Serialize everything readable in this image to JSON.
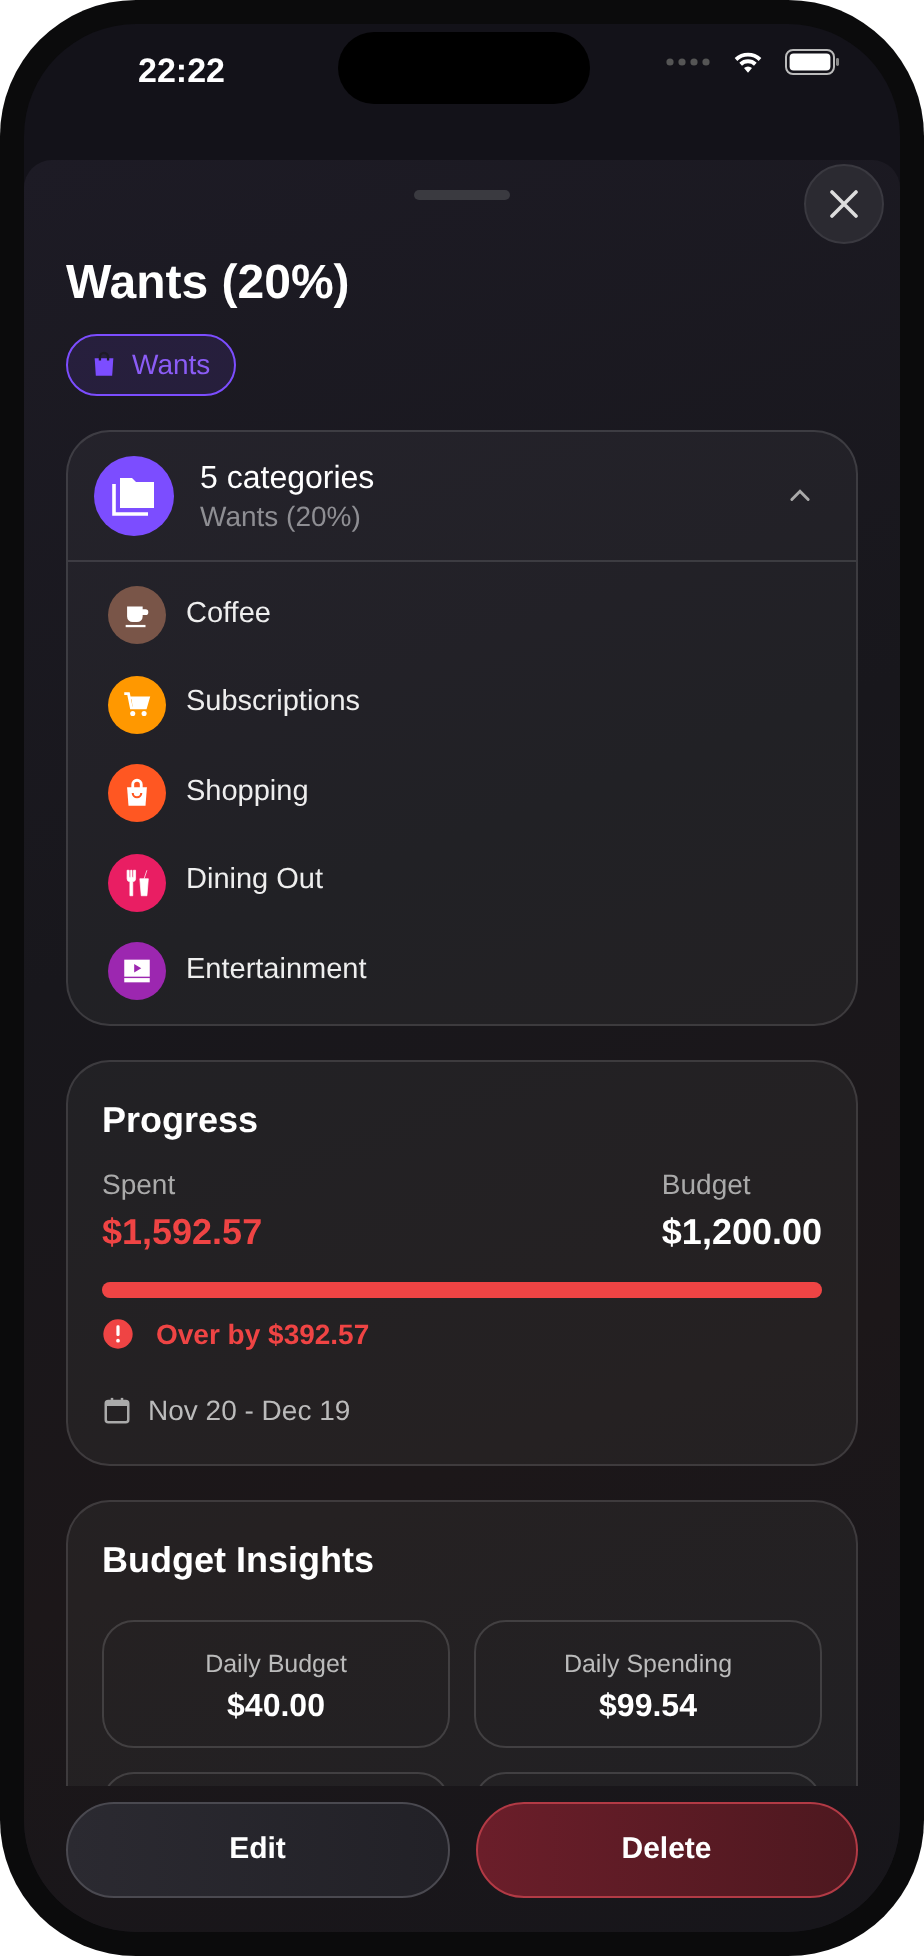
{
  "status_bar": {
    "time": "22:22"
  },
  "sheet": {
    "title": "Wants (20%)",
    "chip": "Wants"
  },
  "categories": {
    "title": "5 categories",
    "subtitle": "Wants (20%)",
    "expanded": true,
    "items": [
      {
        "name": "Coffee",
        "kind": "coffee",
        "color": "#795548"
      },
      {
        "name": "Subscriptions",
        "kind": "cart",
        "color": "#ff9800"
      },
      {
        "name": "Shopping",
        "kind": "bag",
        "color": "#ff5722"
      },
      {
        "name": "Dining Out",
        "kind": "dining",
        "color": "#e91e63"
      },
      {
        "name": "Entertainment",
        "kind": "theater",
        "color": "#9c27b0"
      }
    ]
  },
  "progress": {
    "title": "Progress",
    "spent_label": "Spent",
    "spent": "$1,592.57",
    "budget_label": "Budget",
    "budget": "$1,200.00",
    "level": 1,
    "over": true,
    "warning": "Over by $392.57",
    "period": "Nov 20 - Dec 19"
  },
  "insights": {
    "title": "Budget Insights",
    "tiles": [
      {
        "kind": "value",
        "label": "Daily Budget",
        "value": "$40.00"
      },
      {
        "kind": "value",
        "label": "Daily Spending",
        "value": "$99.54"
      },
      {
        "kind": "cut"
      },
      {
        "kind": "cut"
      }
    ]
  },
  "buttons": [
    {
      "label": "Edit",
      "kind": "secondary"
    },
    {
      "label": "Delete",
      "kind": "danger"
    }
  ]
}
